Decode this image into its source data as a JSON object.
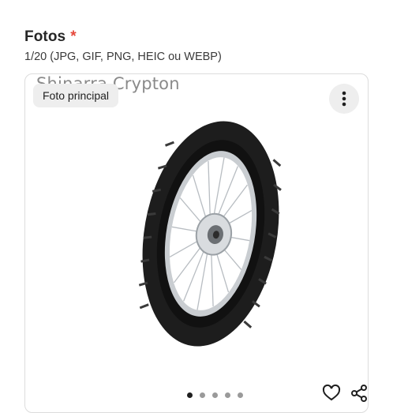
{
  "section": {
    "title": "Fotos",
    "required_mark": "*",
    "subtitle": "1/20 (JPG, GIF, PNG, HEIC ou WEBP)"
  },
  "photo": {
    "caption": "Shinarra Crypton",
    "main_badge": "Foto principal",
    "menu_icon": "more-vertical-icon",
    "pagination": {
      "current": 1,
      "total": 5
    },
    "actions": [
      "heart-icon",
      "share-icon"
    ]
  },
  "colors": {
    "required": "#e5483b",
    "badge_bg": "#eeeeee",
    "tire": "#1c1c1c",
    "rim": "#c9cdd1"
  }
}
